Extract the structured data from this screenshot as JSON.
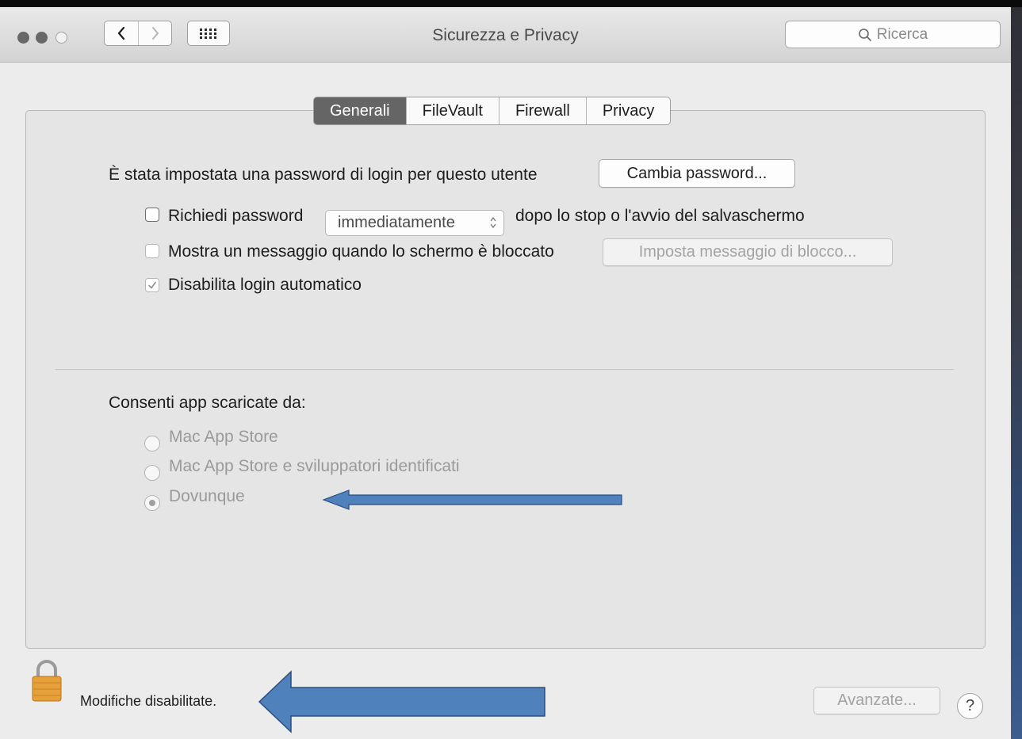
{
  "window": {
    "title": "Sicurezza e Privacy",
    "search_placeholder": "Ricerca"
  },
  "tabs": [
    {
      "label": "Generali",
      "active": true
    },
    {
      "label": "FileVault",
      "active": false
    },
    {
      "label": "Firewall",
      "active": false
    },
    {
      "label": "Privacy",
      "active": false
    }
  ],
  "general": {
    "password_set_text": "È stata impostata una password di login per questo utente",
    "change_password_button": "Cambia password...",
    "require_password": {
      "label": "Richiedi password",
      "checked": false
    },
    "require_password_select": "immediatamente",
    "require_password_suffix": "dopo lo stop o l'avvio del salvaschermo",
    "show_message": {
      "label": "Mostra un messaggio quando lo schermo è bloccato",
      "checked": false
    },
    "set_message_button": "Imposta messaggio di blocco...",
    "disable_autologin": {
      "label": "Disabilita login automatico",
      "checked": true
    }
  },
  "downloads": {
    "heading": "Consenti app scaricate da:",
    "options": [
      {
        "label": "Mac App Store",
        "selected": false
      },
      {
        "label": "Mac App Store e sviluppatori identificati",
        "selected": false
      },
      {
        "label": "Dovunque",
        "selected": true
      }
    ]
  },
  "footer": {
    "lock_status": "Modifiche disabilitate.",
    "advanced_button": "Avanzate...",
    "help": "?"
  },
  "colors": {
    "annotation_arrow": "#4f81bd",
    "lock_body": "#e5a03a",
    "active_tab": "#656565"
  },
  "icons": [
    "back-chevron-icon",
    "forward-chevron-icon",
    "show-all-grid-icon",
    "search-icon",
    "lock-icon",
    "checkmark-icon",
    "stepper-arrows-icon",
    "annotation-arrow-icon"
  ]
}
